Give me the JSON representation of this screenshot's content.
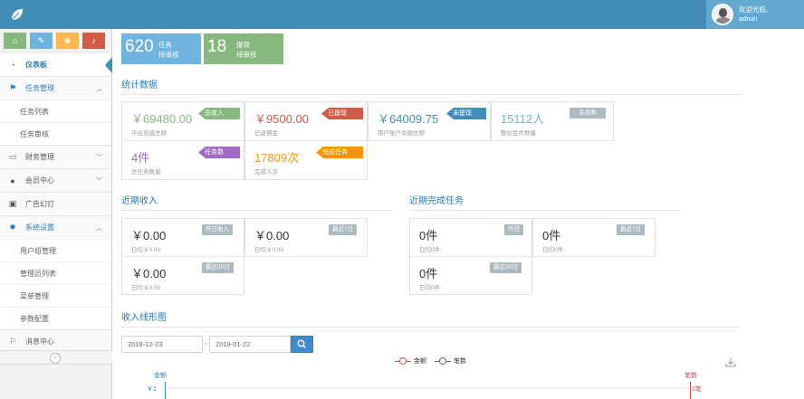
{
  "header": {
    "welcome": "欢迎光临,",
    "username": "admin"
  },
  "sidebar": {
    "items": [
      {
        "label": "仪表板",
        "icon": "dashboard-icon"
      },
      {
        "label": "任务管理",
        "icon": "flag-icon"
      },
      {
        "label": "任务列表"
      },
      {
        "label": "任务审核"
      },
      {
        "label": "财务管理",
        "icon": "desktop-icon"
      },
      {
        "label": "会员中心",
        "icon": "user-icon"
      },
      {
        "label": "广告幻灯",
        "icon": "picture-icon"
      },
      {
        "label": "系统设置",
        "icon": "gear-icon"
      },
      {
        "label": "用户组管理"
      },
      {
        "label": "管理员列表"
      },
      {
        "label": "菜单管理"
      },
      {
        "label": "参数配置"
      },
      {
        "label": "消息中心",
        "icon": "bookmark-icon"
      }
    ]
  },
  "top_stats": [
    {
      "value": "620",
      "line1": "任务",
      "line2": "待审核",
      "color": "#6fb3e0"
    },
    {
      "value": "18",
      "line1": "提现",
      "line2": "待审核",
      "color": "#87b87f"
    }
  ],
  "stats": {
    "title": "统计数据",
    "cards": [
      {
        "value": "￥69480.00",
        "label": "平台充值总额",
        "tag": "总收入",
        "value_color": "#87b87f",
        "tag_color": "#87b87f"
      },
      {
        "value": "￥9500.00",
        "label": "已返佣金",
        "tag": "已提现",
        "value_color": "#d15b47",
        "tag_color": "#d15b47"
      },
      {
        "value": "￥64009.75",
        "label": "用户账户余额总额",
        "tag": "未提现",
        "value_color": "#438eb9",
        "tag_color": "#438eb9"
      },
      {
        "value": "15112人",
        "label": "整站会员数量",
        "tag": "会员数",
        "value_color": "#6fb3e0",
        "tag_color": "#abbac3"
      },
      {
        "value": "4件",
        "label": "总任务数量",
        "tag": "任务数",
        "value_color": "#a069c3",
        "tag_color": "#a069c3"
      },
      {
        "value": "17809次",
        "label": "完成人次",
        "tag": "完成任务",
        "value_color": "#f89406",
        "tag_color": "#f89406"
      }
    ]
  },
  "income": {
    "title": "近期收入",
    "cards": [
      {
        "value": "￥0.00",
        "label": "日均￥0.00",
        "tag": "昨日收入"
      },
      {
        "value": "￥0.00",
        "label": "日均￥0.00",
        "tag": "最近7日"
      },
      {
        "value": "￥0.00",
        "label": "日均￥0.00",
        "tag": "最近30日"
      }
    ]
  },
  "tasks": {
    "title": "近期完成任务",
    "cards": [
      {
        "value": "0件",
        "label": "日均0件",
        "tag": "昨日"
      },
      {
        "value": "0件",
        "label": "日均0件",
        "tag": "最近7日"
      },
      {
        "value": "0件",
        "label": "日均0件",
        "tag": "最近30日"
      }
    ]
  },
  "chart": {
    "title": "收入线形图",
    "date_from": "2018-12-23",
    "date_sep": "-",
    "date_to": "2019-01-22",
    "legend": [
      {
        "name": "金额",
        "color": "#d14a4a"
      },
      {
        "name": "笔数",
        "color": "#666666"
      }
    ],
    "y_left_label": "金额",
    "y_right_label": "笔数",
    "y_left_tick": "￥1",
    "y_right_tick": "1笔"
  }
}
